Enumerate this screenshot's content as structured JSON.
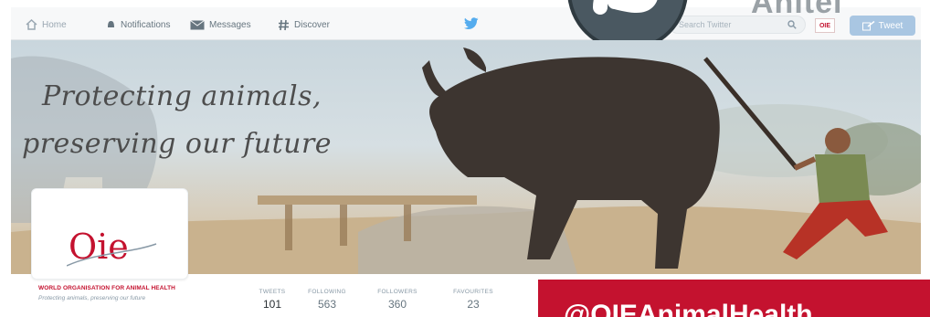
{
  "topnav": {
    "items": [
      {
        "label": "Home",
        "icon": "home-icon"
      },
      {
        "label": "Notifications",
        "icon": "bell-icon"
      },
      {
        "label": "Messages",
        "icon": "envelope-icon"
      },
      {
        "label": "Discover",
        "icon": "hash-icon"
      }
    ],
    "search_placeholder": "Search Twitter",
    "tweet_label": "Tweet",
    "avatar_text": "OIE"
  },
  "overlay": {
    "corner_text": "Anitel"
  },
  "banner": {
    "headline_line1": "Protecting animals,",
    "headline_line2": "preserving our future"
  },
  "profile": {
    "logo_text": "Oie",
    "org_name": "WORLD ORGANISATION FOR ANIMAL HEALTH",
    "org_tagline": "Protecting animals, preserving our future",
    "handle": "@OIEAnimalHealth"
  },
  "stats": [
    {
      "label": "TWEETS",
      "value": "101"
    },
    {
      "label": "FOLLOWING",
      "value": "563"
    },
    {
      "label": "FOLLOWERS",
      "value": "360"
    },
    {
      "label": "FAVOURITES",
      "value": "23"
    }
  ],
  "colors": {
    "brand_red": "#c4122f",
    "twitter_blue": "#55acee",
    "tweet_button": "#a9c6e2"
  }
}
